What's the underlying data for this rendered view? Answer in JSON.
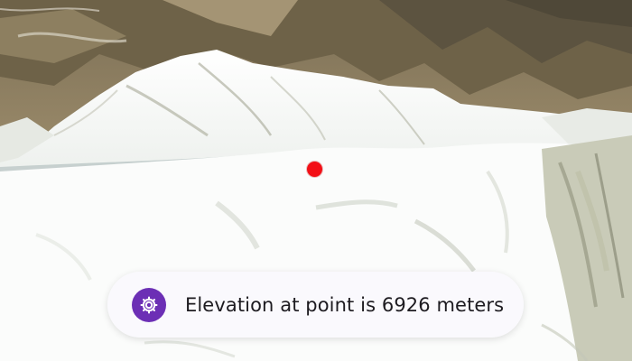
{
  "map_scene": {
    "marker": {
      "name": "elevation-point",
      "color": "#f30f16"
    }
  },
  "elevation_toast": {
    "icon": "settings-gear-icon",
    "icon_color": "#6c2fb5",
    "message": "Elevation at point is 6926 meters"
  }
}
